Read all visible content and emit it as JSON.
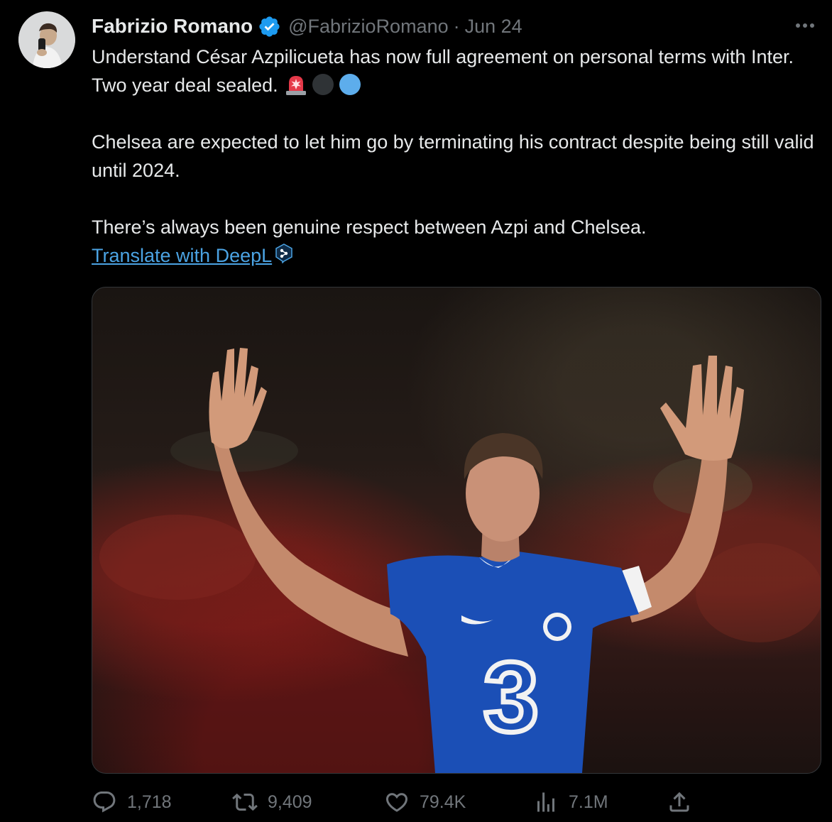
{
  "tweet": {
    "author_name": "Fabrizio Romano",
    "handle": "@FabrizioRomano",
    "separator": "·",
    "date": "Jun 24",
    "paragraphs": [
      "Understand César Azpilicueta has now full agreement on personal terms with Inter. Two year deal sealed.",
      "Chelsea are expected to let him go by terminating his contract despite being still valid until 2024.",
      "There’s always been genuine respect between Azpi and Chelsea."
    ],
    "emojis": [
      "police-light-emoji",
      "black-circle-emoji",
      "blue-circle-emoji"
    ],
    "translate_link": "Translate with DeepL",
    "media_shirt_text": "3"
  },
  "actions": {
    "replies": "1,718",
    "retweets": "9,409",
    "likes": "79.4K",
    "views": "7.1M"
  },
  "colors": {
    "background": "#000000",
    "text_primary": "#e7e9ea",
    "text_secondary": "#71767b",
    "link": "#4ba3e3",
    "verified": "#1d9bf0",
    "border": "#333639"
  },
  "icons": [
    "verified-badge-icon",
    "more-icon",
    "deepl-icon",
    "reply-icon",
    "retweet-icon",
    "like-icon",
    "views-icon",
    "share-icon"
  ]
}
